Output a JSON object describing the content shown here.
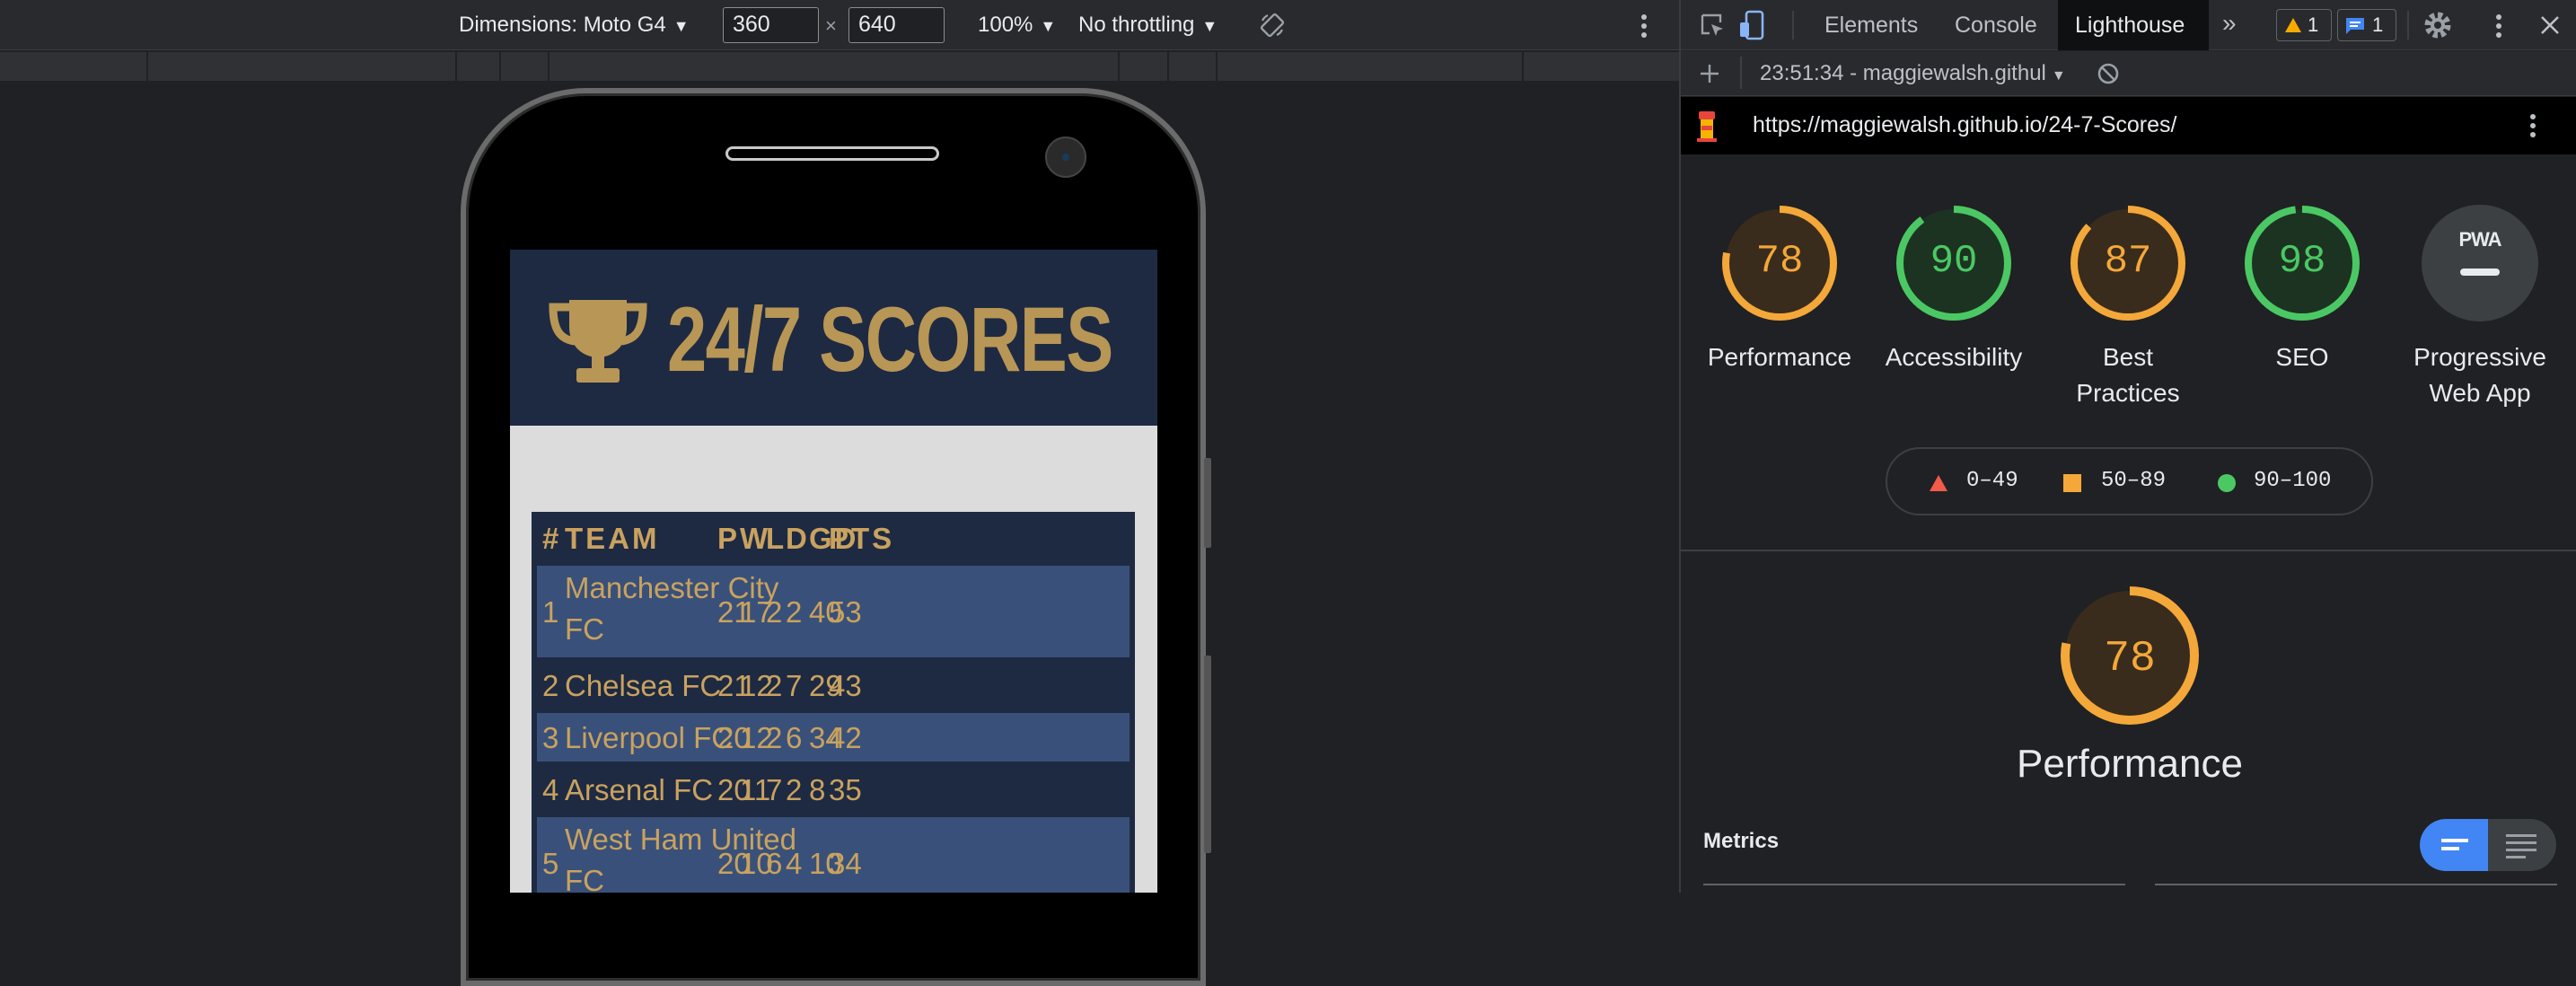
{
  "device_toolbar": {
    "dimensions_label": "Dimensions: Moto G4",
    "width_value": "360",
    "times": "×",
    "height_value": "640",
    "zoom": "100%",
    "throttling": "No throttling"
  },
  "site": {
    "title": "24/7 SCORES",
    "table": {
      "headers": [
        "#",
        "TEAM",
        "P",
        "W",
        "L",
        "D",
        "GD",
        "PTS"
      ],
      "rows": [
        {
          "pos": "1",
          "team_line1": "Manchester City",
          "team_line2": "FC",
          "p": "21",
          "w": "17",
          "l": "2",
          "d": "2",
          "gd": "40",
          "pts": "53"
        },
        {
          "pos": "2",
          "team_line1": "Chelsea FC",
          "team_line2": "",
          "p": "21",
          "w": "12",
          "l": "2",
          "d": "7",
          "gd": "29",
          "pts": "43"
        },
        {
          "pos": "3",
          "team_line1": "Liverpool FC",
          "team_line2": "",
          "p": "20",
          "w": "12",
          "l": "2",
          "d": "6",
          "gd": "34",
          "pts": "42"
        },
        {
          "pos": "4",
          "team_line1": "Arsenal FC",
          "team_line2": "",
          "p": "20",
          "w": "11",
          "l": "7",
          "d": "2",
          "gd": "8",
          "pts": "35"
        },
        {
          "pos": "5",
          "team_line1": "West Ham United",
          "team_line2": "FC",
          "p": "20",
          "w": "10",
          "l": "6",
          "d": "4",
          "gd": "10",
          "pts": "34"
        }
      ]
    }
  },
  "devtools": {
    "tabs": [
      "Elements",
      "Console",
      "Lighthouse"
    ],
    "active_tab": "Lighthouse",
    "warning_count": "1",
    "message_count": "1",
    "report_select": "23:51:34 - maggiewalsh.githul",
    "url": "https://maggiewalsh.github.io/24-7-Scores/",
    "gauges": [
      {
        "score": 78,
        "label_line1": "Performance",
        "label_line2": "",
        "color": "#f4a83a"
      },
      {
        "score": 90,
        "label_line1": "Accessibility",
        "label_line2": "",
        "color": "#4bc864"
      },
      {
        "score": 87,
        "label_line1": "Best",
        "label_line2": "Practices",
        "color": "#f4a83a"
      },
      {
        "score": 98,
        "label_line1": "SEO",
        "label_line2": "",
        "color": "#4bc864"
      }
    ],
    "pwa": {
      "badge": "PWA",
      "label_line1": "Progressive",
      "label_line2": "Web App"
    },
    "legend": {
      "fail": "0–49",
      "average": "50–89",
      "pass": "90–100"
    },
    "colors": {
      "fail": "#f25a4a",
      "average": "#f4a83a",
      "pass": "#4bc864",
      "accent": "#4285f4"
    },
    "performance": {
      "score": 78,
      "label": "Performance"
    },
    "metrics_heading": "Metrics"
  }
}
